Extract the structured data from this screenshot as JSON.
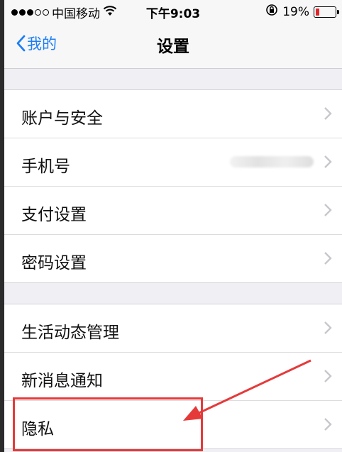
{
  "status_bar": {
    "carrier": "中国移动",
    "time": "下午9:03",
    "battery": "19%",
    "battery_level": 0.19
  },
  "nav": {
    "back_label": "我的",
    "title": "设置"
  },
  "groups": [
    {
      "items": [
        {
          "label": "账户与安全"
        },
        {
          "label": "手机号"
        },
        {
          "label": "支付设置"
        },
        {
          "label": "密码设置"
        }
      ]
    },
    {
      "items": [
        {
          "label": "生活动态管理"
        },
        {
          "label": "新消息通知"
        },
        {
          "label": "隐私"
        }
      ]
    }
  ],
  "colors": {
    "accent": "#1c7ef5",
    "annotation": "#e53a3a",
    "battery_low": "#e0262b"
  },
  "icons": [
    "wifi-icon",
    "lock-rotation-icon",
    "battery-icon",
    "back-chevron-icon",
    "chevron-right-icon",
    "annotation-arrow"
  ]
}
